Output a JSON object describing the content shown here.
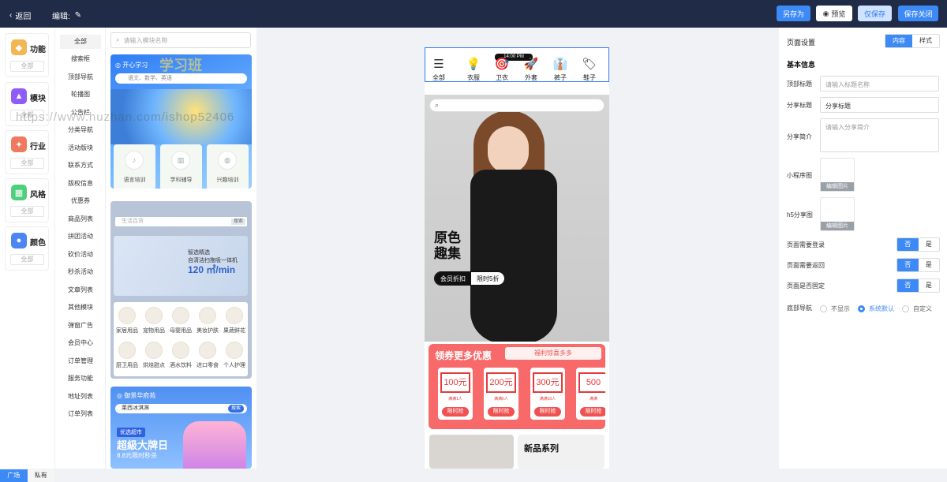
{
  "topbar": {
    "back": "返回",
    "edit_label": "编辑:",
    "buttons": {
      "save_as": "另存为",
      "preview": "预览",
      "save_only": "仅保存",
      "save_close": "保存关闭"
    }
  },
  "left_categories": [
    {
      "name": "功能",
      "all": "全部",
      "color": "#f2b653"
    },
    {
      "name": "模块",
      "all": "全部",
      "color": "#8f5cf7"
    },
    {
      "name": "行业",
      "all": "全部",
      "color": "#f07a5f"
    },
    {
      "name": "风格",
      "all": "全部",
      "color": "#4fcf7c"
    },
    {
      "name": "颜色",
      "all": "全部",
      "color": "#4d86f2"
    }
  ],
  "left_tabs": {
    "plaza": "广场",
    "private": "私有"
  },
  "module_list": [
    "全部",
    "搜索框",
    "顶部导航",
    "轮播图",
    "公告栏",
    "分类导航",
    "活动版块",
    "联系方式",
    "版权信息",
    "优惠券",
    "商品列表",
    "拼团活动",
    "砍价活动",
    "秒杀活动",
    "文章列表",
    "其他模块",
    "弹窗广告",
    "会员中心",
    "订单管理",
    "服务功能",
    "地址列表",
    "订单列表"
  ],
  "template_search": {
    "placeholder": "请输入模块名称"
  },
  "thumb1": {
    "tag": "开心学习",
    "big": "学习班",
    "search": "语文、数学、英语",
    "cards": [
      "语言培训",
      "学科辅导",
      "兴趣培训"
    ]
  },
  "thumb2": {
    "search": "生活百货",
    "search_btn": "搜索",
    "b1": "智选精选",
    "b2": "自清洁扫拖吸一体机",
    "b3": "120 ㎡/min",
    "grid": [
      "家居用品",
      "宠物用品",
      "母婴用品",
      "美妆护肤",
      "果蔬鲜花",
      "厨卫用品",
      "烘焙甜点",
      "酒水饮料",
      "进口零食",
      "个人护理"
    ]
  },
  "thumb3": {
    "loc": "御景华府苑",
    "search": "莱西冰淇淋",
    "search_btn": "搜索",
    "tag": "优选超市",
    "big": "超級大牌日",
    "sub": "8.8元限时秒杀"
  },
  "phone": {
    "status_time": "14:00 PM",
    "nav": [
      {
        "label": "全部",
        "icon": "☰"
      },
      {
        "label": "衣服",
        "icon": "💡"
      },
      {
        "label": "卫衣",
        "icon": "🎯"
      },
      {
        "label": "外套",
        "icon": "🚀"
      },
      {
        "label": "裤子",
        "icon": "👔"
      },
      {
        "label": "鞋子",
        "icon": "🏷"
      }
    ],
    "hero_title_1": "原色",
    "hero_title_2": "趣集",
    "pill_a": "会员折扣",
    "pill_b": "限时5折",
    "coupon_title": "领券更多优惠",
    "coupon_badge": "福利惊喜多多",
    "coupons": [
      {
        "v": "100元",
        "r": "满满1人",
        "g": "限时抢"
      },
      {
        "v": "200元",
        "r": "满满5人",
        "g": "限时抢"
      },
      {
        "v": "300元",
        "r": "满满10人",
        "g": "限时抢"
      },
      {
        "v": "500",
        "r": "满满",
        "g": "限时抢"
      }
    ],
    "new_series": "新品系列"
  },
  "right": {
    "title": "页面设置",
    "tab_content": "内容",
    "tab_style": "样式",
    "section": "基本信息",
    "top_title_label": "顶部标题",
    "top_title_ph": "请输入标题名称",
    "share_title_label": "分享标题",
    "share_title_val": "分享标题",
    "share_desc_label": "分享简介",
    "share_desc_ph": "请输入分享简介",
    "mini_img_label": "小程序图",
    "h5_img_label": "h5分享图",
    "edit_img": "编辑图片",
    "need_login": "页面需要登录",
    "need_back": "页面需要返回",
    "is_fixed": "页面是否固定",
    "no": "否",
    "yes": "是",
    "bottom_nav": "底部导航",
    "opt_hide": "不显示",
    "opt_default": "系统默认",
    "opt_custom": "自定义"
  },
  "watermark": "https://www.huzhan.com/ishop52406"
}
